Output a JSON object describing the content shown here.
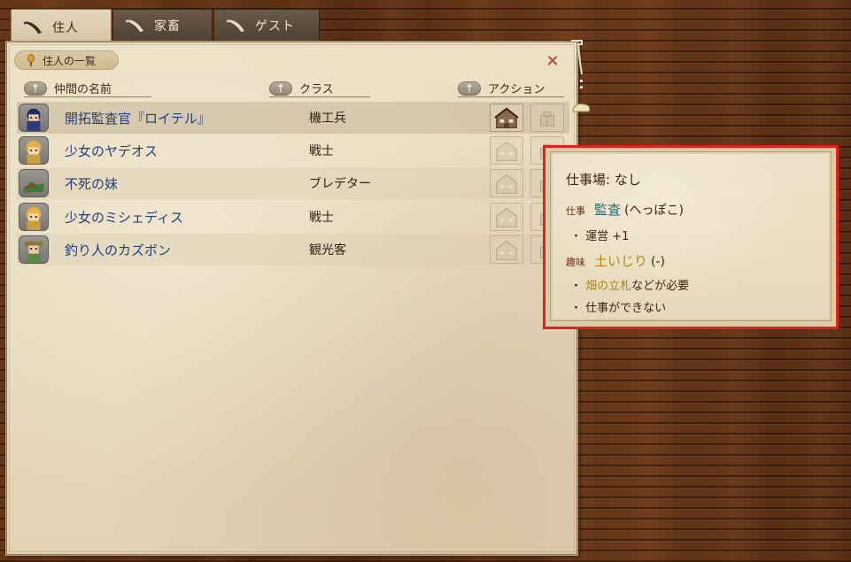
{
  "tabs": [
    {
      "label": "住人",
      "active": true
    },
    {
      "label": "家畜",
      "active": false
    },
    {
      "label": "ゲスト",
      "active": false
    }
  ],
  "panel": {
    "title": "住人の一覧",
    "close_symbol": "×",
    "columns": {
      "name": "仲間の名前",
      "class": "クラス",
      "action": "アクション"
    },
    "rows": [
      {
        "name": "開拓監査官『ロイテル』",
        "class": "機工兵",
        "portrait": "blue-haired-officer-portrait",
        "selected": true
      },
      {
        "name": "少女のヤデオス",
        "class": "戦士",
        "portrait": "blonde-girl-portrait"
      },
      {
        "name": "不死の妹",
        "class": "ブレデター",
        "portrait": "green-creature-portrait"
      },
      {
        "name": "少女のミシェディス",
        "class": "戦士",
        "portrait": "blonde-girl-portrait"
      },
      {
        "name": "釣り人のカズボン",
        "class": "観光客",
        "portrait": "fisherman-portrait"
      }
    ],
    "action_icons": [
      "house-icon",
      "workplace-icon"
    ]
  },
  "tooltip": {
    "workplace": "仕事場: なし",
    "work_label": "仕事",
    "work_value": "監査",
    "work_rank": "(へっぽこ)",
    "work_bullet": "・ 運営 +1",
    "hobby_label": "趣味",
    "hobby_value": "土いじり",
    "hobby_rank": "(-)",
    "hobby_bullet_em": "畑の立札",
    "hobby_bullet_rest": "などが必要",
    "hobby_bullet2": "・ 仕事ができない",
    "bullet_prefix": "・ "
  },
  "colors": {
    "highlight_border": "#e2201e",
    "name_text": "#23407a",
    "work_text": "#2a6a6a",
    "hobby_text": "#b08a10"
  }
}
